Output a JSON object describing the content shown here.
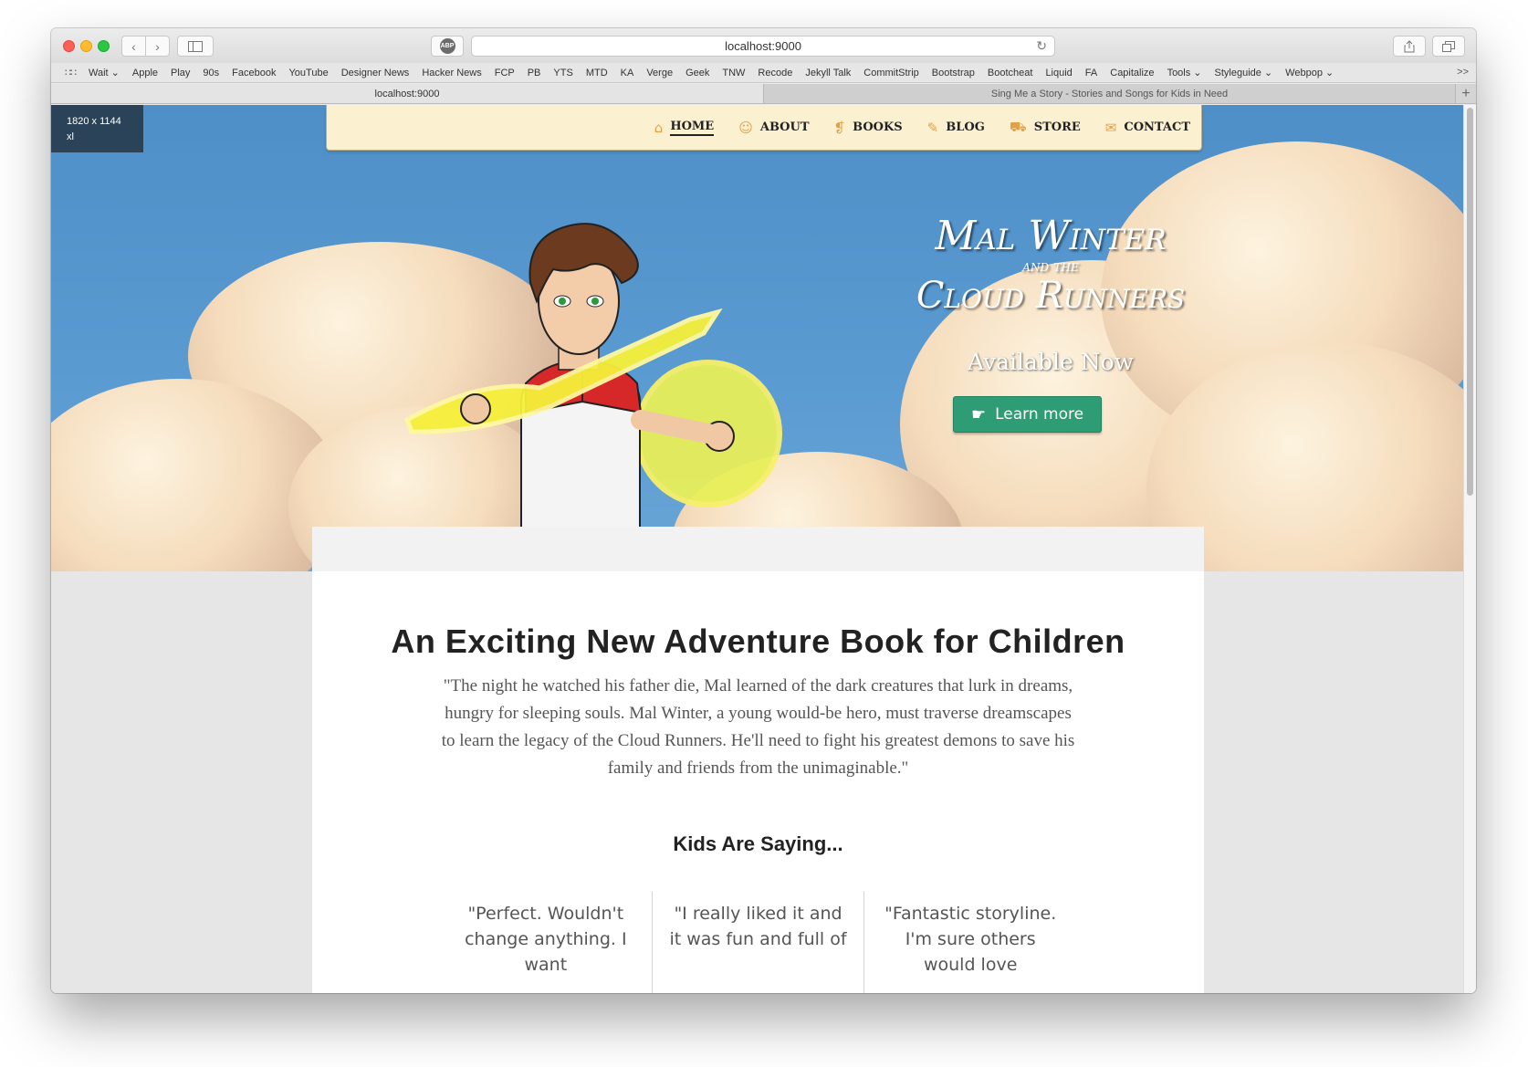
{
  "browser": {
    "url": "localhost:9000",
    "abp_label": "ABP",
    "bookmarks": [
      "Wait ⌄",
      "Apple",
      "Play",
      "90s",
      "Facebook",
      "YouTube",
      "Designer News",
      "Hacker News",
      "FCP",
      "PB",
      "YTS",
      "MTD",
      "KA",
      "Verge",
      "Geek",
      "TNW",
      "Recode",
      "Jekyll Talk",
      "CommitStrip",
      "Bootstrap",
      "Bootcheat",
      "Liquid",
      "FA",
      "Capitalize",
      "Tools ⌄",
      "Styleguide ⌄",
      "Webpop ⌄"
    ],
    "bookmarks_more": ">>",
    "tabs": [
      {
        "label": "localhost:9000",
        "active": true
      },
      {
        "label": "Sing Me a Story - Stories and Songs for Kids in Need",
        "active": false
      }
    ],
    "new_tab_label": "+"
  },
  "size_badge": {
    "dimensions": "1820 x 1144",
    "breakpoint": "xl"
  },
  "nav": {
    "items": [
      {
        "label": "HOME",
        "icon": "home-icon",
        "glyph": "⌂"
      },
      {
        "label": "ABOUT",
        "icon": "user-icon",
        "glyph": "☺"
      },
      {
        "label": "BOOKS",
        "icon": "book-icon",
        "glyph": "❡"
      },
      {
        "label": "BLOG",
        "icon": "pencil-icon",
        "glyph": "✎"
      },
      {
        "label": "STORE",
        "icon": "cart-icon",
        "glyph": "⛟"
      },
      {
        "label": "CONTACT",
        "icon": "envelope-icon",
        "glyph": "✉"
      }
    ],
    "active": "HOME"
  },
  "hero": {
    "title_line1": "Mal Winter",
    "title_line2": "and the",
    "title_line3": "Cloud Runners",
    "subtitle": "Available Now",
    "cta_label": "Learn more",
    "cta_icon": "thumbs-up-icon"
  },
  "main": {
    "title": "An Exciting New Adventure Book for Children",
    "quote": "\"The night he watched his father die, Mal learned of the dark creatures that lurk in dreams, hungry for sleeping souls. Mal Winter, a young would-be hero, must traverse dreamscapes to learn the legacy of the Cloud Runners. He'll need to fight his greatest demons to save his family and friends from the unimaginable.\"",
    "kids_title": "Kids Are Saying...",
    "testimonials": [
      "\"Perfect. Wouldn't change anything. I want",
      "\"I really liked it and it was fun and full of",
      "\"Fantastic storyline. I'm sure others would love"
    ]
  },
  "colors": {
    "nav_bg": "#fbf0cf",
    "nav_icon": "#e3a04a",
    "cta_bg": "#2e9c74",
    "sky": "#4e8fc7",
    "badge_bg": "#2b4358"
  }
}
